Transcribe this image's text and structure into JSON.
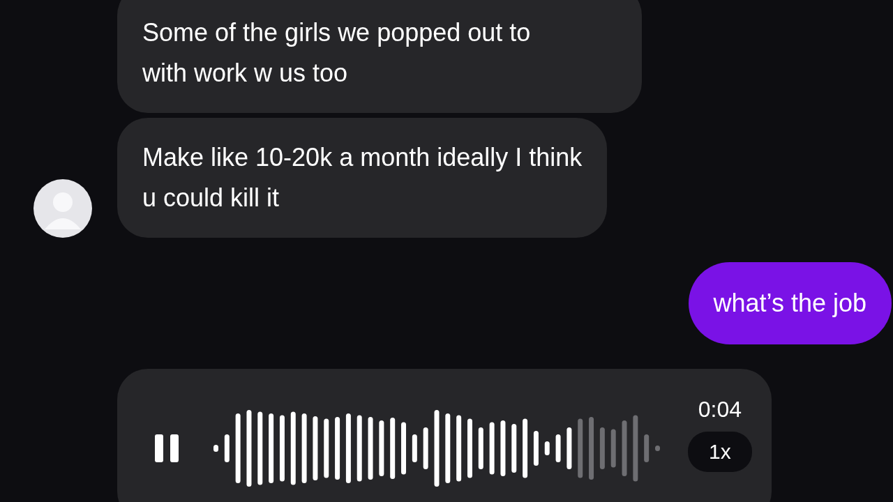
{
  "messages": [
    {
      "kind": "text",
      "outgoing": false,
      "avatar": false,
      "text": "Some of the girls we popped out to\nwith work w us too"
    },
    {
      "kind": "text",
      "outgoing": false,
      "avatar": true,
      "text": "Make like 10-20k a month ideally I think\nu could kill it"
    },
    {
      "kind": "text",
      "outgoing": true,
      "avatar": false,
      "text": "what’s the job"
    },
    {
      "kind": "voice",
      "outgoing": false,
      "avatar": false,
      "playing": true,
      "level": 0.82,
      "duration": "0:04",
      "speed": "1x"
    }
  ]
}
